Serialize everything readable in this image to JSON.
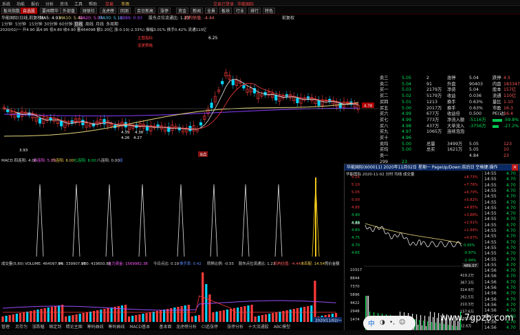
{
  "menu": {
    "items": [
      "系统",
      "功能",
      "报价",
      "分析",
      "资讯",
      "工具",
      "帮助"
    ],
    "trade_link": "交易",
    "market_link": "市场",
    "login_status": "交易已登录",
    "stock_name": "华能国际"
  },
  "quickbar": [
    "板块指数",
    "自选股",
    "要闻精华",
    "外部盘",
    "财联社",
    "龙虎榜",
    "回测",
    "百日新高",
    "涨停",
    "资金",
    "新闻",
    "全景",
    "板块",
    "行业",
    "排行",
    "特色"
  ],
  "quickbar_active": 1,
  "toolbar": {
    "name": "华能国际(日线,前复权)",
    "f1": "MA5: 4.93",
    "f2": "MA10: 5.42",
    "f3": "MA20: 5.07",
    "f4": "MA30: 5.11",
    "f5": "KB89: 0.93",
    "f6": "股东点位流通比: 1.23",
    "f7": "机构估值: -4.44",
    "label_main": "主图指标",
    "label_adj": "前复权"
  },
  "periods": {
    "items": [
      "1分钟",
      "5分钟",
      "15分钟",
      "30分钟",
      "60分钟",
      "日线",
      "周线",
      "月线",
      "多周期"
    ],
    "info": "2020/02/一 开4.90 高4.95 低4.80 收4.90 量464098 额2.20亿 涨-0.10(-2.33%) 振幅3.01% 换手0.42% 流通110亿 大力发电"
  },
  "main_chart": {
    "high_label": "6.25",
    "mid_label_a": "4.35",
    "mid_label_b": "4.36",
    "low_label_a": "4.26",
    "low_label_b": "4.27",
    "bottom_label": "3.93",
    "label_a": "主图指标",
    "label_b": "变更策略",
    "price_tag": "4.78",
    "marker": "B点"
  },
  "indicator1": {
    "header": {
      "t1": "MACD 四连阳: 4.00",
      "t2": "五连阳: 5.00",
      "t3": "六连阳: 6.00",
      "t4": "七连阳: 6.00",
      "t5": "八连阳: 0.00",
      "t6": "双"
    }
  },
  "volume_panel": {
    "header": {
      "t1": "成交量(5,60) VOLUME: 464097.84",
      "t2": "V5: 339907.88",
      "t3": "V60: 419650.88",
      "t4": "主力资金: 1569982.38",
      "t5": "今日点比: 0.19",
      "t6": "换手率: 0.42",
      "t7": "转移比例: -0.55",
      "t8": "股东点位流通比: 1.23",
      "t9": "机构估值: -4.44",
      "t10": "未匹配: 14.54",
      "t11": "竞价金额"
    },
    "axis_label": "2020/11/02/一"
  },
  "quote": {
    "rows": [
      {
        "l1": "卖三",
        "v1": "5.05",
        "q1": "2",
        "l2": "涨停",
        "v2": "5.04",
        "l3": "跌停",
        "v3": "4.5"
      },
      {
        "l1": "卖二",
        "v1": "5.04",
        "q1": "91",
        "l2": "外盘",
        "v2": "90403",
        "l3": "内盘",
        "v3": "183347"
      },
      {
        "l1": "买一",
        "v1": "5.03",
        "q1": "2179万",
        "l2": "净资",
        "v2": "5.04",
        "l3": "股本",
        "v3": "157亿"
      },
      {
        "l1": "买二",
        "v1": "5.02",
        "q1": "5179万",
        "l2": "收益",
        "v2": "0.036",
        "l3": "流通",
        "v3": "110亿"
      },
      {
        "l1": "买四",
        "v1": "5.01",
        "q1": "1213",
        "l2": "换手",
        "v2": "0.63%",
        "l3": "量比",
        "v3": "1.10"
      },
      {
        "l1": "买五",
        "v1": "5.00",
        "q1": "2017万",
        "l2": "换手",
        "v2": "0.63%",
        "l3": "市盈",
        "v3": "16.3"
      },
      {
        "l1": "买六",
        "v1": "4.99",
        "q1": "677万",
        "l2": "收益倍",
        "v2": "0.500",
        "l3": "PE(动)",
        "v3": "16.4"
      },
      {
        "l1": "买七",
        "v1": "4.99",
        "q1": "773万",
        "l2": "净流入额",
        "v2": "-5116万",
        "l3": "",
        "v3": "-59.8%"
      },
      {
        "l1": "买八",
        "v1": "4.98",
        "q1": "437万",
        "l2": "大单流入",
        "v2": "-3756万",
        "l3": "",
        "v3": "-27.2%"
      },
      {
        "l1": "买九",
        "v1": "4.97",
        "q1": "1065万",
        "l2": "连续泡泡",
        "v2": "",
        "l3": "",
        "v3": ""
      },
      {
        "l1": "买十",
        "v1": "4.96",
        "q1": "",
        "l2": "",
        "v2": "",
        "l3": "",
        "v3": ""
      },
      {
        "l1": "卖均",
        "v1": "5.00",
        "q1": "总量",
        "l2": "3499万",
        "v2": "5.05",
        "l3": "",
        "v3": "123"
      },
      {
        "l1": "买均",
        "v1": "5.00",
        "q1": "总买",
        "l2": "1621万",
        "v2": "5.05",
        "l3": "",
        "v3": "10"
      },
      {
        "l1": "卖一",
        "v1": "",
        "q1": "",
        "l2": "",
        "v2": "4.84",
        "l3": "",
        "v3": "23"
      },
      {
        "l1": "299",
        "v1": "23",
        "q1": "",
        "l2": "",
        "v2": "",
        "l3": "",
        "v3": ""
      }
    ]
  },
  "popup": {
    "title": "华能国际(600011) 2020年11月02日 星期一 PageUp/Down:前后日 空格键:操作",
    "close": "×",
    "subheader": "华能国际 2020-11-02 分时 均线 成交量",
    "price_ticks": [
      "5.15",
      "5.10",
      "5.05",
      "5.00",
      "4.95",
      "4.90",
      "4.85",
      "4.80",
      "4.75",
      "4.70",
      "4.65"
    ],
    "pct_ticks": [
      "+8.73%",
      "+7.76%",
      "+6.79%",
      "+5.82%",
      "+4.85%",
      "+3.88%",
      "+2.91%",
      "+1.94%",
      "+0.97%",
      "0.00%",
      "-0.97%",
      "-1.94%"
    ],
    "vol_ticks": [
      "10317",
      "8844",
      "7370",
      "5896",
      "4422",
      "2948",
      "1474"
    ],
    "right_ticks": [
      "419.2万",
      "367.3万",
      "314.9万",
      "262.5万",
      "210.3万",
      "157.6万",
      "105.1万",
      "52.6万"
    ],
    "left_marker": "4.88",
    "trade_tag": "489.07",
    "trades": [
      {
        "t": "14:55",
        "p": "4.70"
      },
      {
        "t": "14:55",
        "p": "4.70"
      },
      {
        "t": "14:55",
        "p": "4.70"
      },
      {
        "t": "14:55",
        "p": "4.70"
      },
      {
        "t": "14:55",
        "p": "4.70"
      },
      {
        "t": "14:55",
        "p": "4.70"
      },
      {
        "t": "14:55",
        "p": "4.70"
      },
      {
        "t": "14:55",
        "p": "4.70"
      },
      {
        "t": "14:55",
        "p": "4.70"
      },
      {
        "t": "14:55",
        "p": "4.70"
      },
      {
        "t": "14:55",
        "p": "4.70"
      },
      {
        "t": "14:55",
        "p": "4.70"
      },
      {
        "t": "14:55",
        "p": "4.70"
      },
      {
        "t": "14:55",
        "p": "4.70"
      },
      {
        "t": "14:55",
        "p": "4.70"
      },
      {
        "t": "14:55",
        "p": "4.70"
      },
      {
        "t": "14:55",
        "p": "4.70"
      },
      {
        "t": "14:56",
        "p": "4.70"
      },
      {
        "t": "14:56",
        "p": "4.70"
      },
      {
        "t": "14:56",
        "p": "4.70"
      },
      {
        "t": "14:56",
        "p": "4.70"
      },
      {
        "t": "14:56",
        "p": "4.70"
      },
      {
        "t": "14:56",
        "p": "4.70"
      },
      {
        "t": "14:56",
        "p": "4.70"
      },
      {
        "t": "14:56",
        "p": "4.70"
      },
      {
        "t": "14:56",
        "p": "4.70"
      },
      {
        "t": "14:56",
        "p": "4.70"
      },
      {
        "t": "14:56",
        "p": "4.70"
      }
    ]
  },
  "ime": {
    "label": "中"
  },
  "watermark": "www.7gpzb.com",
  "bottom_tabs": [
    "管理",
    "另存为",
    "涨跌幅",
    "缩定到",
    "精论主图",
    "筹码曲线",
    "筹码曲线",
    "MACD基本",
    "基本面",
    "龙虎榜分析",
    "CI追涨停",
    "涨停分析",
    "十大流通股",
    "ABC模型"
  ],
  "colors": {
    "up": "#ff3b3b",
    "down": "#00d4ff",
    "ma_purple": "#9a4dff",
    "ma_yellow": "#e8d87a",
    "ma_white": "#e6e6e6",
    "green": "#00e35b",
    "gold": "#f1c81a"
  }
}
